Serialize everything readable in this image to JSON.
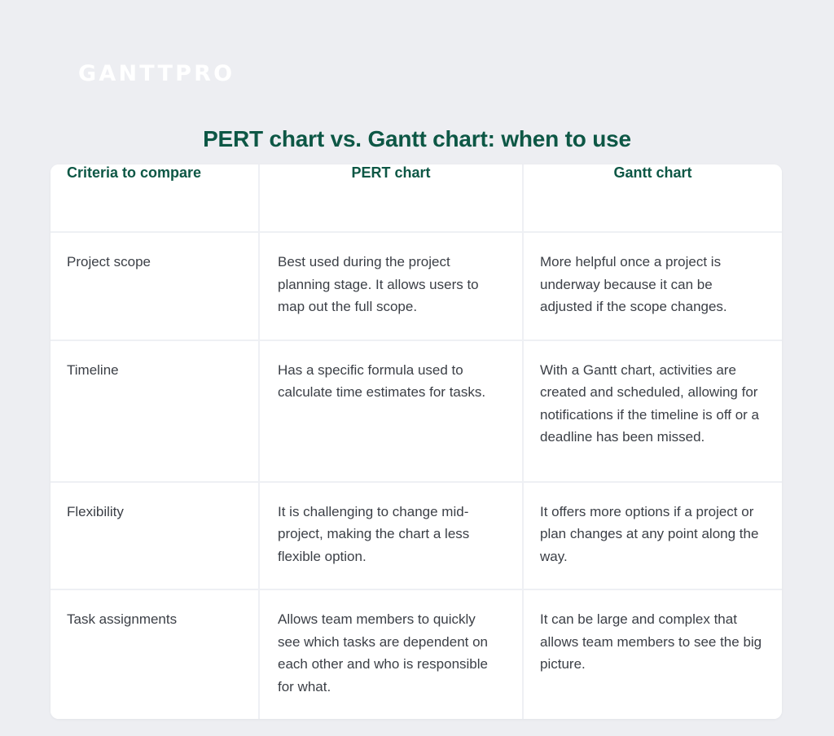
{
  "brand": {
    "logo_text": "GANTTPRO"
  },
  "title": "PERT chart vs. Gantt chart: when to use",
  "table": {
    "headers": [
      "Criteria to compare",
      "PERT chart",
      "Gantt chart"
    ],
    "rows": [
      {
        "criteria": "Project scope",
        "pert": "Best used during the project planning stage. It allows users to map out the full scope.",
        "gantt": "More helpful once a project is underway because it can be adjusted if the scope changes."
      },
      {
        "criteria": "Timeline",
        "pert": "Has a specific formula used to calculate time estimates for tasks.",
        "gantt": "With a Gantt chart, activities are created and scheduled, allowing for notifications if the timeline is off or a deadline has been missed."
      },
      {
        "criteria": "Flexibility",
        "pert": "It is challenging to change mid-project, making the chart a less flexible option.",
        "gantt": "It offers more options if a project or plan changes at any point along the way."
      },
      {
        "criteria": "Task assignments",
        "pert": "Allows team members to quickly see which tasks are dependent on each other and who is responsible for what.",
        "gantt": "It can be large and complex that allows team members to see the big picture."
      }
    ]
  },
  "colors": {
    "page_background": "#edeef2",
    "card_background": "#ffffff",
    "accent_teal": "#0d5745",
    "body_text": "#3b3f46",
    "divider": "#eef0f4",
    "logo": "#ffffff"
  }
}
